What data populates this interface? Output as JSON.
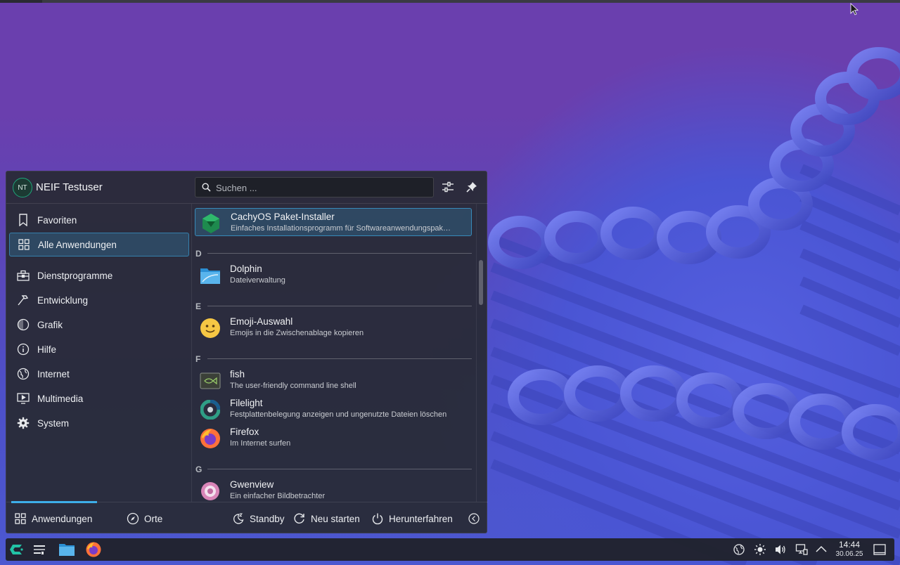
{
  "launcher": {
    "user": {
      "initials": "NT",
      "name": "NEIF Testuser"
    },
    "search": {
      "placeholder": "Suchen ..."
    },
    "sidebar": [
      {
        "label": "Favoriten",
        "icon": "bookmark-icon",
        "active": false
      },
      {
        "label": "Alle Anwendungen",
        "icon": "grid-icon",
        "active": true
      },
      {
        "label": "Dienstprogramme",
        "icon": "toolbox-icon",
        "active": false
      },
      {
        "label": "Entwicklung",
        "icon": "hammer-icon",
        "active": false
      },
      {
        "label": "Grafik",
        "icon": "palette-icon",
        "active": false
      },
      {
        "label": "Hilfe",
        "icon": "info-icon",
        "active": false
      },
      {
        "label": "Internet",
        "icon": "globe-icon",
        "active": false
      },
      {
        "label": "Multimedia",
        "icon": "monitor-play-icon",
        "active": false
      },
      {
        "label": "System",
        "icon": "gear-icon",
        "active": false
      }
    ],
    "apps": [
      {
        "name": "CachyOS Paket-Installer",
        "desc": "Einfaches Installationsprogramm für Softwareanwendungspak…",
        "icon": "cachyos-package-installer-icon",
        "active": true
      },
      {
        "letter": "D"
      },
      {
        "name": "Dolphin",
        "desc": "Dateiverwaltung",
        "icon": "folder-icon"
      },
      {
        "letter": "E"
      },
      {
        "name": "Emoji-Auswahl",
        "desc": "Emojis in die Zwischenablage kopieren",
        "icon": "emoji-icon"
      },
      {
        "letter": "F"
      },
      {
        "name": "fish",
        "desc": "The user-friendly command line shell",
        "icon": "fish-terminal-icon"
      },
      {
        "name": "Filelight",
        "desc": "Festplattenbelegung anzeigen und ungenutzte Dateien löschen",
        "icon": "filelight-icon"
      },
      {
        "name": "Firefox",
        "desc": "Im Internet surfen",
        "icon": "firefox-icon"
      },
      {
        "letter": "G"
      },
      {
        "name": "Gwenview",
        "desc": "Ein einfacher Bildbetrachter",
        "icon": "gwenview-icon"
      }
    ],
    "footer": {
      "tabs": [
        {
          "label": "Anwendungen",
          "icon": "grid-icon",
          "active": true
        },
        {
          "label": "Orte",
          "icon": "compass-icon",
          "active": false
        }
      ],
      "actions": [
        {
          "label": "Standby",
          "icon": "sleep-icon"
        },
        {
          "label": "Neu starten",
          "icon": "restart-icon"
        },
        {
          "label": "Herunterfahren",
          "icon": "power-icon"
        }
      ]
    }
  },
  "taskbar": {
    "launchers": [
      "cachyos-menu-icon",
      "desktop-overview-icon",
      "dolphin-icon",
      "firefox-icon"
    ],
    "tray": [
      "network-globe-icon",
      "brightness-icon",
      "volume-icon",
      "network-wired-icon",
      "expand-tray-icon"
    ],
    "clock": {
      "time": "14:44",
      "date": "30.06.25"
    }
  },
  "colors": {
    "accent": "#3daee9",
    "panel": "#282a34",
    "wallpaper": "#5b46b8"
  }
}
